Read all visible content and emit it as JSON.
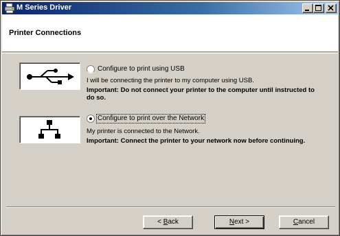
{
  "window": {
    "title": "M Series Driver",
    "icon": "printer-app-icon",
    "controls": [
      "minimize-icon",
      "maximize-icon",
      "close-icon"
    ]
  },
  "header": {
    "title": "Printer Connections"
  },
  "options": [
    {
      "id": "usb",
      "icon": "usb-icon",
      "selected": false,
      "label": "Configure to print using USB",
      "description": "I will be connecting the printer to my computer using USB.",
      "important_line1": "Important: Do not connect your printer to the computer until instructed to",
      "important_line2": "do so."
    },
    {
      "id": "network",
      "icon": "network-icon",
      "selected": true,
      "label": "Configure to print over the Network",
      "description": "My printer is connected to the Network.",
      "important_line1": "Important: Connect the printer to your network now before continuing."
    }
  ],
  "buttons": {
    "back_pre": "< ",
    "back_mn": "B",
    "back_post": "ack",
    "next_mn": "N",
    "next_post": "ext >",
    "cancel_mn": "C",
    "cancel_post": "ancel"
  }
}
